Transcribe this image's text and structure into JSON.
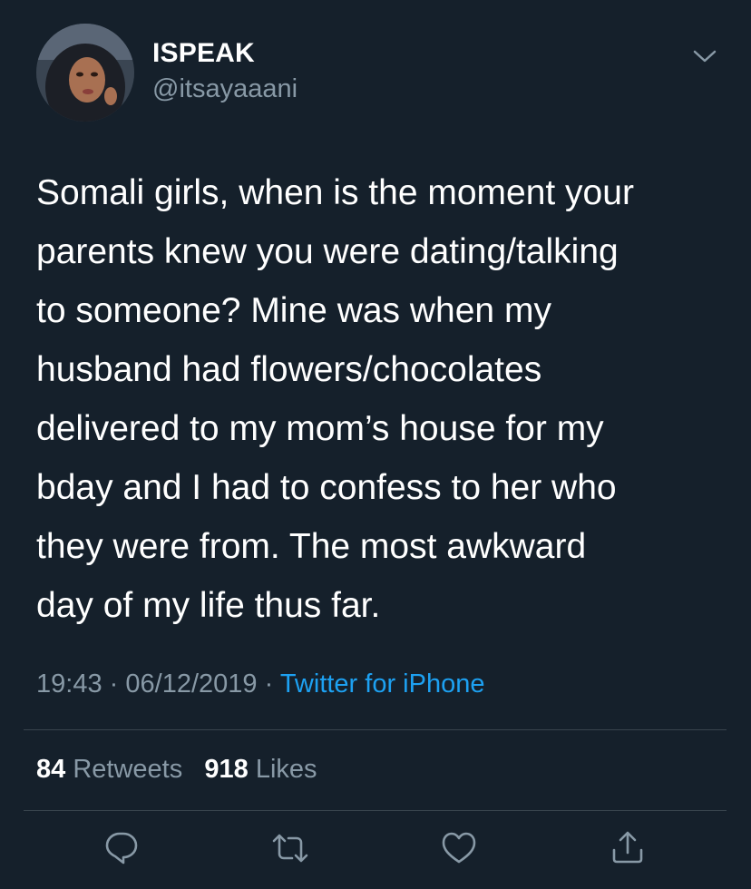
{
  "author": {
    "display_name": "ISPEAK",
    "handle": "@itsayaaani"
  },
  "tweet": {
    "lines": [
      "Somali girls, when is the moment your",
      "parents knew you were dating/talking",
      "to someone? Mine was when my",
      "husband had flowers/chocolates",
      "delivered to my mom’s house for my",
      "bday and I had to confess to her who",
      "they were from. The most awkward",
      "day of my life thus far."
    ],
    "time": "19:43",
    "date": "06/12/2019",
    "separator": "·",
    "source": "Twitter for iPhone"
  },
  "stats": {
    "retweets_count": "84",
    "retweets_label": "Retweets",
    "likes_count": "918",
    "likes_label": "Likes"
  },
  "actions": {
    "icons": [
      "reply-icon",
      "retweet-icon",
      "like-icon",
      "share-icon"
    ]
  },
  "colors": {
    "background": "#15202b",
    "text": "#ffffff",
    "secondary": "#8899a6",
    "link": "#1da1f2",
    "divider": "#38444d"
  }
}
